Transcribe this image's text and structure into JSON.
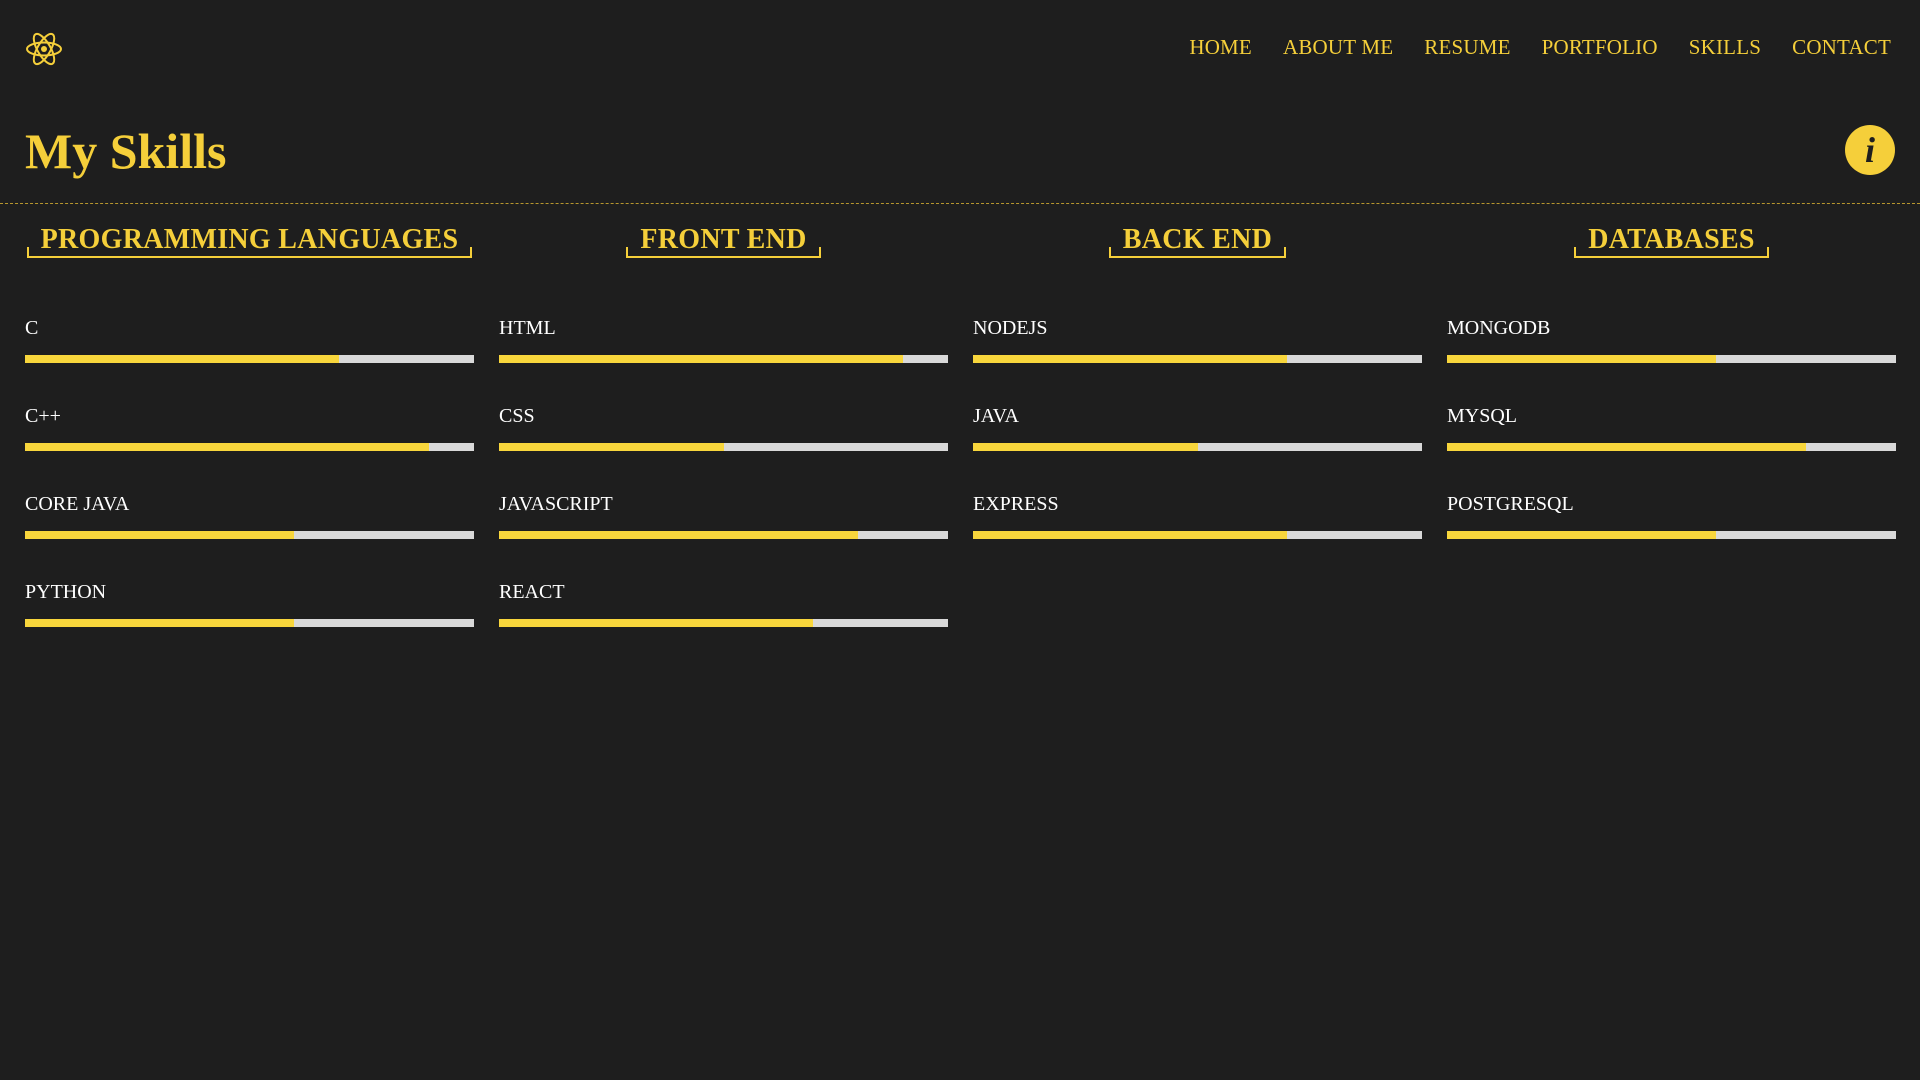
{
  "nav": {
    "logo_icon": "atom-icon",
    "items": [
      "HOME",
      "ABOUT ME",
      "RESUME",
      "PORTFOLIO",
      "SKILLS",
      "CONTACT"
    ]
  },
  "page": {
    "title": "My Skills",
    "info_icon": "info-icon",
    "info_glyph": "i"
  },
  "colors": {
    "background": "#1e1e1e",
    "accent": "#f5cf3a",
    "track": "#d9d9d9",
    "text": "#ffffff"
  },
  "categories": [
    {
      "title": "PROGRAMMING LANGUAGES",
      "skills": [
        {
          "name": "C",
          "level": 0.7
        },
        {
          "name": "C++",
          "level": 0.9
        },
        {
          "name": "CORE JAVA",
          "level": 0.6
        },
        {
          "name": "PYTHON",
          "level": 0.6
        }
      ]
    },
    {
      "title": "FRONT END",
      "skills": [
        {
          "name": "HTML",
          "level": 0.9
        },
        {
          "name": "CSS",
          "level": 0.5
        },
        {
          "name": "JAVASCRIPT",
          "level": 0.8
        },
        {
          "name": "REACT",
          "level": 0.7
        }
      ]
    },
    {
      "title": "BACK END",
      "skills": [
        {
          "name": "NODEJS",
          "level": 0.7
        },
        {
          "name": "JAVA",
          "level": 0.5
        },
        {
          "name": "EXPRESS",
          "level": 0.7
        }
      ]
    },
    {
      "title": "DATABASES",
      "skills": [
        {
          "name": "MONGODB",
          "level": 0.6
        },
        {
          "name": "MYSQL",
          "level": 0.8
        },
        {
          "name": "POSTGRESQL",
          "level": 0.6
        }
      ]
    }
  ]
}
